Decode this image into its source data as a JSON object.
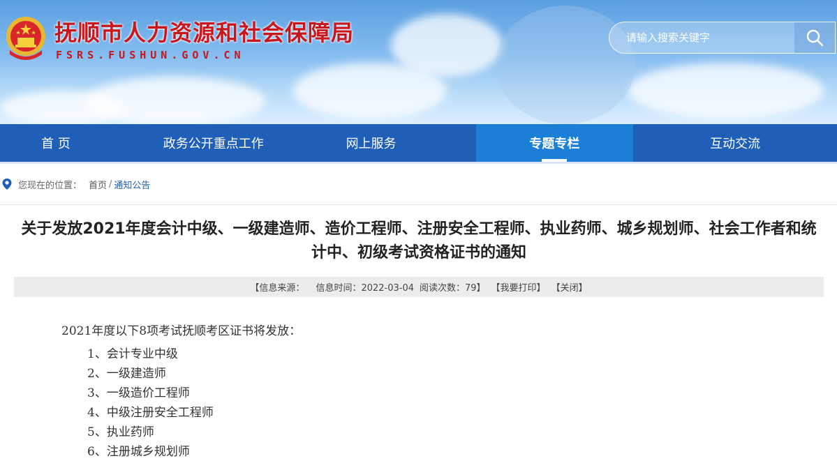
{
  "header": {
    "site_title": "抚顺市人力资源和社会保障局",
    "site_domain": "FSRS.FUSHUN.GOV.CN",
    "search_placeholder": "请输入搜索关键字",
    "emblem_icon": "national-emblem-icon",
    "search_icon": "search-icon"
  },
  "nav": {
    "items": [
      {
        "label": "首 页",
        "active": false
      },
      {
        "label": "政务公开重点工作",
        "active": false
      },
      {
        "label": "网上服务",
        "active": false
      },
      {
        "label": "专题专栏",
        "active": true
      },
      {
        "label": "互动交流",
        "active": false
      }
    ],
    "bar_color": "#1f5fb8",
    "active_color": "#1b7fd6"
  },
  "breadcrumb": {
    "prefix": "您现在的位置：",
    "home": "首页",
    "separator": "/",
    "current": "通知公告",
    "icon": "location-pin-icon"
  },
  "article": {
    "title": "关于发放2021年度会计中级、一级建造师、造价工程师、注册安全工程师、执业药师、城乡规划师、社会工作者和统计中、初级考试资格证书的通知",
    "meta": {
      "source_label": "【信息来源：",
      "time_label": "信息时间：2022-03-04",
      "views_label": "阅读次数：79】",
      "print_label": "【我要打印】",
      "close_label": "【关闭】"
    },
    "intro": "2021年度以下8项考试抚顺考区证书将发放：",
    "items": [
      "1、会计专业中级",
      "2、一级建造师",
      "3、一级造价工程师",
      "4、中级注册安全工程师",
      "5、执业药师",
      "6、注册城乡规划师"
    ]
  }
}
